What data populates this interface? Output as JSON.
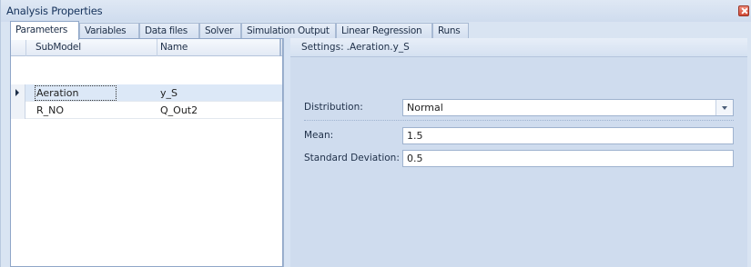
{
  "window": {
    "title": "Analysis Properties"
  },
  "tabs": [
    {
      "label": "Parameters",
      "active": true
    },
    {
      "label": "Variables"
    },
    {
      "label": "Data files"
    },
    {
      "label": "Solver"
    },
    {
      "label": "Simulation Output"
    },
    {
      "label": "Linear Regression"
    },
    {
      "label": "Runs"
    }
  ],
  "grid": {
    "columns": [
      "SubModel",
      "Name"
    ],
    "rows": [
      {
        "submodel": "Aeration",
        "name": "y_S",
        "selected": true
      },
      {
        "submodel": "R_NO",
        "name": "Q_Out2"
      }
    ]
  },
  "settings": {
    "header_prefix": "Settings:",
    "header_path": ".Aeration.y_S",
    "distribution_label": "Distribution:",
    "distribution_value": "Normal",
    "mean_label": "Mean:",
    "mean_value": "1.5",
    "std_label": "Standard Deviation:",
    "std_value": "0.5"
  },
  "icons": {
    "close": "close-icon",
    "row_indicator": "row-indicator-arrow-icon",
    "dropdown": "chevron-down-icon"
  }
}
